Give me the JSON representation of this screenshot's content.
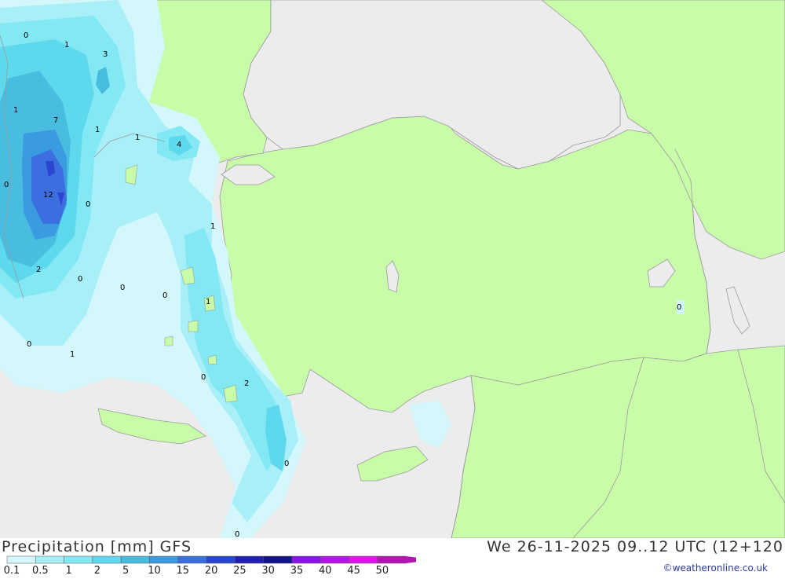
{
  "title": {
    "left": "Precipitation [mm] GFS",
    "right": "We 26-11-2025 09..12 UTC (12+120"
  },
  "credit": "©weatheronline.co.uk",
  "legend": {
    "labels": [
      "0.1",
      "0.5",
      "1",
      "2",
      "5",
      "10",
      "15",
      "20",
      "25",
      "30",
      "35",
      "40",
      "45",
      "50"
    ],
    "colors": [
      "#d4f7fb",
      "#a8eff7",
      "#82e8f3",
      "#5ed8ec",
      "#48bde0",
      "#3a9be0",
      "#3c6ee0",
      "#2a45d0",
      "#2020b0",
      "#12128a",
      "#8a14e8",
      "#b414e6",
      "#e014e6",
      "#b414b4"
    ]
  },
  "map_labels": [
    {
      "id": "a",
      "text": "0"
    },
    {
      "id": "b",
      "text": "1"
    },
    {
      "id": "c",
      "text": "3"
    },
    {
      "id": "d",
      "text": "1"
    },
    {
      "id": "e",
      "text": "7"
    },
    {
      "id": "f",
      "text": "1"
    },
    {
      "id": "g",
      "text": "1"
    },
    {
      "id": "h",
      "text": "4"
    },
    {
      "id": "i",
      "text": "0"
    },
    {
      "id": "j",
      "text": "12"
    },
    {
      "id": "k",
      "text": "0"
    },
    {
      "id": "l",
      "text": "1"
    },
    {
      "id": "m",
      "text": "2"
    },
    {
      "id": "n",
      "text": "0"
    },
    {
      "id": "o",
      "text": "0"
    },
    {
      "id": "p",
      "text": "0"
    },
    {
      "id": "q",
      "text": "1"
    },
    {
      "id": "r",
      "text": "0"
    },
    {
      "id": "s",
      "text": "1"
    },
    {
      "id": "t",
      "text": "0"
    },
    {
      "id": "u",
      "text": "2"
    },
    {
      "id": "v",
      "text": "0"
    },
    {
      "id": "w",
      "text": "0"
    },
    {
      "id": "x",
      "text": "0"
    }
  ]
}
